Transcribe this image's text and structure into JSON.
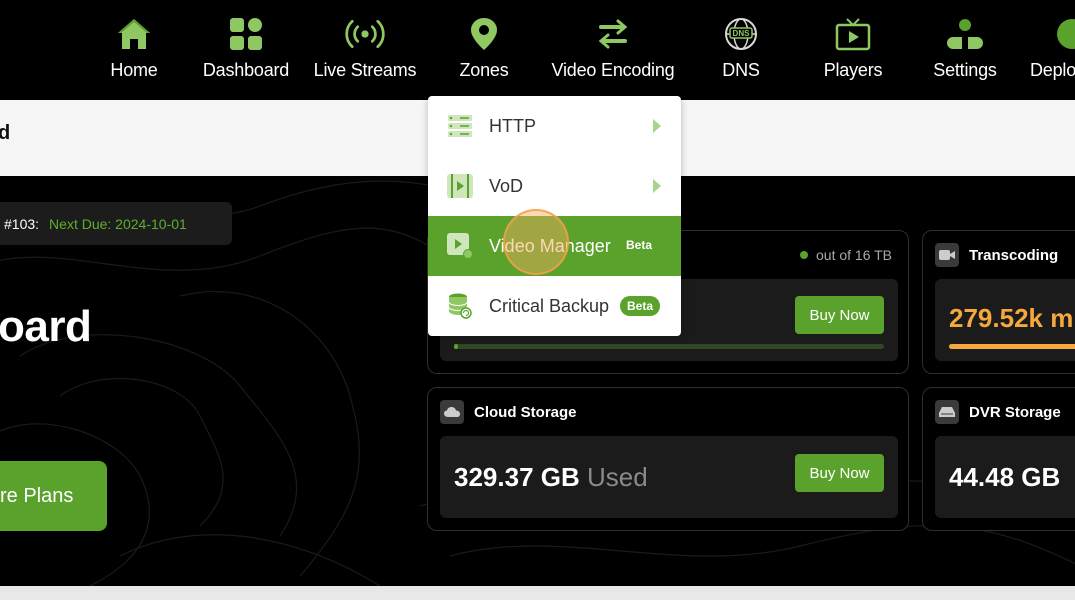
{
  "nav": {
    "items": [
      {
        "label": "Home",
        "icon": "home-icon"
      },
      {
        "label": "Dashboard",
        "icon": "dashboard-icon"
      },
      {
        "label": "Live Streams",
        "icon": "broadcast-icon"
      },
      {
        "label": "Zones",
        "icon": "location-pin-icon"
      },
      {
        "label": "Video Encoding",
        "icon": "encoding-icon"
      },
      {
        "label": "DNS",
        "icon": "dns-globe-icon"
      },
      {
        "label": "Players",
        "icon": "tv-play-icon"
      },
      {
        "label": "Settings",
        "icon": "user-settings-icon"
      },
      {
        "label": "Deplo",
        "icon": "deploy-icon"
      }
    ]
  },
  "breadcrumb": {
    "text": "d"
  },
  "hero": {
    "invoice_number": "#103:",
    "next_due": "Next Due: 2024-10-01",
    "title": "oard",
    "plans_button": "re Plans"
  },
  "zones_menu": {
    "items": [
      {
        "label": "HTTP",
        "icon": "server-rack-icon",
        "has_submenu": true
      },
      {
        "label": "VoD",
        "icon": "film-play-icon",
        "has_submenu": true
      },
      {
        "label": "Video Manager",
        "icon": "video-manager-icon",
        "badge": "Beta",
        "active": true
      },
      {
        "label": "Critical Backup",
        "icon": "database-backup-icon",
        "badge": "Beta"
      }
    ]
  },
  "cards": {
    "bandwidth": {
      "out_of": "out of 16 TB",
      "buy_label": "Buy Now",
      "usage_fraction": 0.01
    },
    "transcoding": {
      "title": "Transcoding",
      "value": "279.52k m"
    },
    "cloud_storage": {
      "title": "Cloud Storage",
      "value": "329.37 GB",
      "used_label": "Used",
      "buy_label": "Buy Now"
    },
    "dvr_storage": {
      "title": "DVR Storage",
      "value": "44.48 GB"
    }
  },
  "colors": {
    "accent_green": "#5aa22c",
    "orange": "#f5a93c",
    "background": "#000000"
  }
}
